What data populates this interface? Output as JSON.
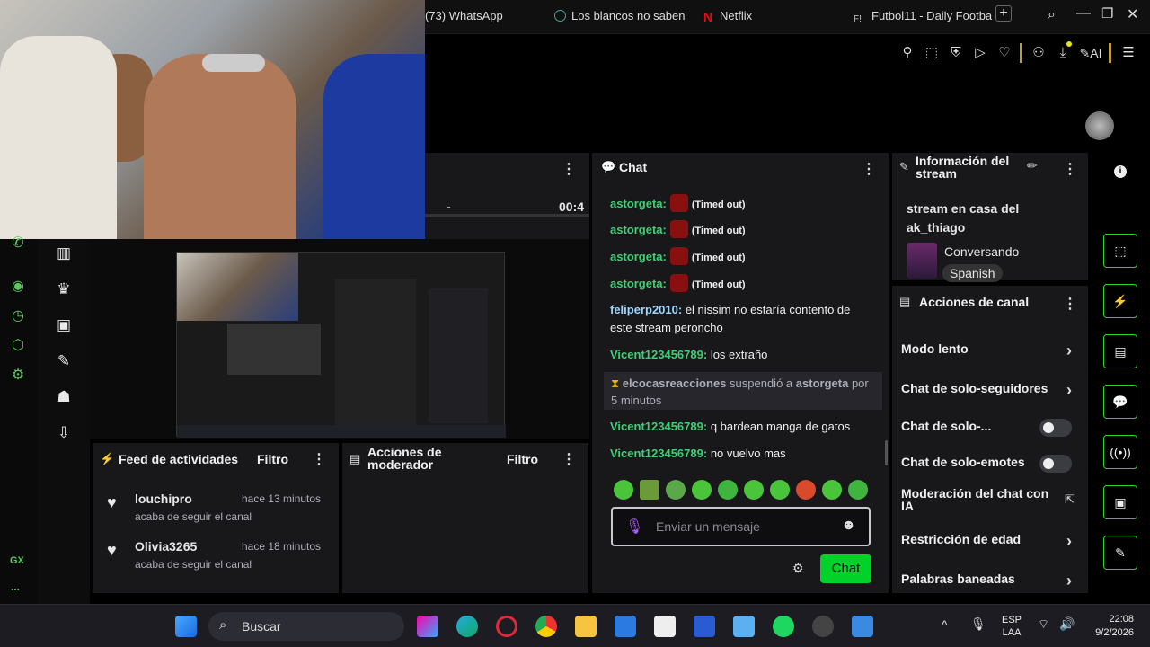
{
  "browser": {
    "tabs": [
      {
        "label": "(73) WhatsApp"
      },
      {
        "label": "Los blancos no saben"
      },
      {
        "label": "Netflix"
      },
      {
        "label": "Futbol11 - Daily Footba"
      }
    ],
    "new_tab": "+"
  },
  "player": {
    "time": "00:4",
    "dash": "-"
  },
  "chat": {
    "title": "Chat",
    "messages": [
      {
        "user": "astorgeta:",
        "text": "(Timed out)"
      },
      {
        "user": "astorgeta:",
        "text": "(Timed out)"
      },
      {
        "user": "astorgeta:",
        "text": "(Timed out)"
      },
      {
        "user": "astorgeta:",
        "text": "(Timed out)"
      },
      {
        "user": "feliperp2010:",
        "text": "el nissim no estaría contento de este stream peroncho"
      },
      {
        "user": "Vicent123456789:",
        "text": "los extraño"
      },
      {
        "user": "Vicent123456789:",
        "text": "q bardean manga de gatos"
      },
      {
        "user": "Vicent123456789:",
        "text": "no vuelvo mas"
      }
    ],
    "system": {
      "mod": "elcocasreacciones",
      "action": "suspendió a",
      "target": "astorgeta",
      "rest": "por 5 minutos"
    },
    "input_placeholder": "Enviar un mensaje",
    "send_label": "Chat"
  },
  "info": {
    "title": "Información del stream",
    "stream_title": "stream en casa del ak_thiago",
    "category": "Conversando",
    "language": "Spanish"
  },
  "channel_actions": {
    "title": "Acciones de canal",
    "items": [
      {
        "label": "Modo lento",
        "kind": "chevron"
      },
      {
        "label": "Chat de solo-seguidores",
        "kind": "chevron"
      },
      {
        "label": "Chat de solo-...",
        "kind": "toggle"
      },
      {
        "label": "Chat de solo-emotes",
        "kind": "toggle"
      },
      {
        "label": "Moderación del chat con IA",
        "kind": "external"
      },
      {
        "label": "Restricción de edad",
        "kind": "chevron"
      },
      {
        "label": "Palabras baneadas",
        "kind": "chevron"
      }
    ]
  },
  "feed": {
    "title": "Feed de actividades",
    "filter": "Filtro",
    "events": [
      {
        "user": "louchipro",
        "time": "hace 13 minutos",
        "text": "acaba de seguir el canal"
      },
      {
        "user": "Olivia3265",
        "time": "hace 18 minutos",
        "text": "acaba de seguir el canal"
      }
    ]
  },
  "mod_actions": {
    "title": "Acciones de moderador",
    "filter": "Filtro"
  },
  "sidebar": {
    "gx_label": "GX",
    "more": "..."
  },
  "taskbar": {
    "search": "Buscar",
    "lang": "ESP",
    "lang2": "LAA",
    "time": "22:08",
    "date": "9/2/2026"
  },
  "toolbar": {
    "ai_label": "AI"
  }
}
